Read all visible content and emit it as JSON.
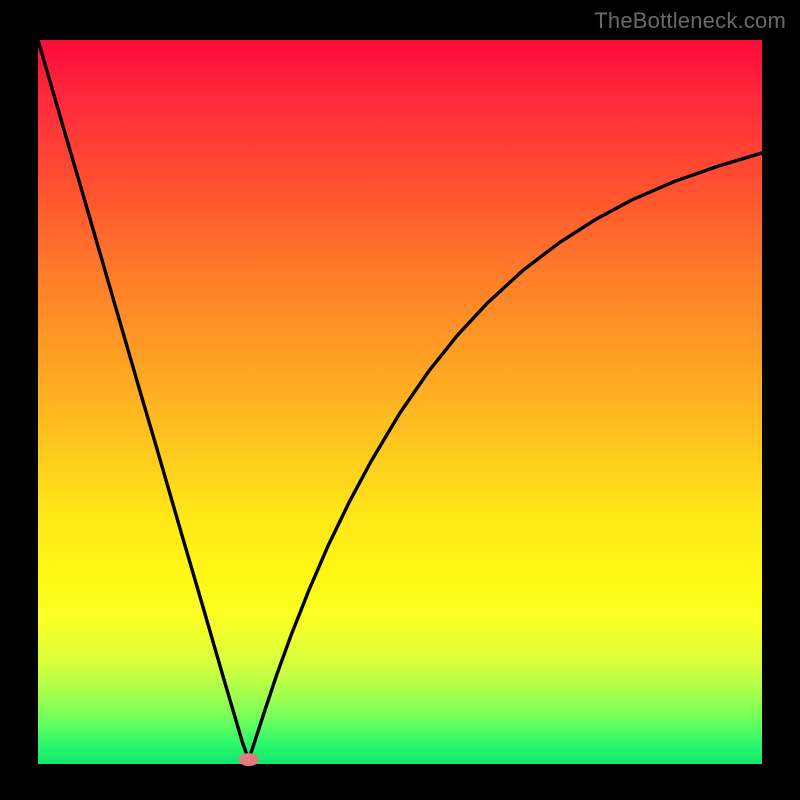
{
  "watermark": "TheBottleneck.com",
  "chart_data": {
    "type": "line",
    "title": "",
    "xlabel": "",
    "ylabel": "",
    "xlim": [
      0,
      100
    ],
    "ylim": [
      0,
      100
    ],
    "grid": false,
    "legend": false,
    "marker": {
      "x": 29.1,
      "y": 0.6,
      "color": "#e47a7a"
    },
    "gradient_stops": [
      {
        "pos": 0,
        "color": "#ff0a3a"
      },
      {
        "pos": 8,
        "color": "#ff2a3c"
      },
      {
        "pos": 20,
        "color": "#ff5030"
      },
      {
        "pos": 32,
        "color": "#ff7b2a"
      },
      {
        "pos": 44,
        "color": "#ffa024"
      },
      {
        "pos": 56,
        "color": "#ffc71e"
      },
      {
        "pos": 66,
        "color": "#ffe818"
      },
      {
        "pos": 74,
        "color": "#fff814"
      },
      {
        "pos": 80,
        "color": "#faff24"
      },
      {
        "pos": 86,
        "color": "#d8ff3c"
      },
      {
        "pos": 90,
        "color": "#a8ff4c"
      },
      {
        "pos": 94,
        "color": "#6cff5c"
      },
      {
        "pos": 97,
        "color": "#30f86a"
      },
      {
        "pos": 100,
        "color": "#10e870"
      }
    ],
    "series": [
      {
        "name": "left-branch",
        "x": [
          0.0,
          2.0,
          4.0,
          6.0,
          8.0,
          10.0,
          12.0,
          14.0,
          16.0,
          18.0,
          20.0,
          22.0,
          24.0,
          25.5,
          27.0,
          28.2,
          29.1
        ],
        "y": [
          100.0,
          93.1,
          86.2,
          79.4,
          72.5,
          65.6,
          58.7,
          51.8,
          45.0,
          38.1,
          31.2,
          24.4,
          17.5,
          12.3,
          7.2,
          3.1,
          0.6
        ]
      },
      {
        "name": "right-branch",
        "x": [
          29.1,
          30.0,
          31.2,
          33.0,
          35.0,
          37.5,
          40.0,
          43.0,
          46.0,
          50.0,
          54.0,
          58.0,
          62.0,
          67.0,
          72.0,
          77.0,
          82.0,
          88.0,
          94.0,
          100.0
        ],
        "y": [
          0.6,
          3.3,
          7.0,
          12.4,
          17.9,
          24.2,
          30.0,
          36.2,
          41.8,
          48.5,
          54.3,
          59.3,
          63.6,
          68.2,
          72.0,
          75.2,
          77.9,
          80.5,
          82.6,
          84.4
        ]
      }
    ]
  }
}
